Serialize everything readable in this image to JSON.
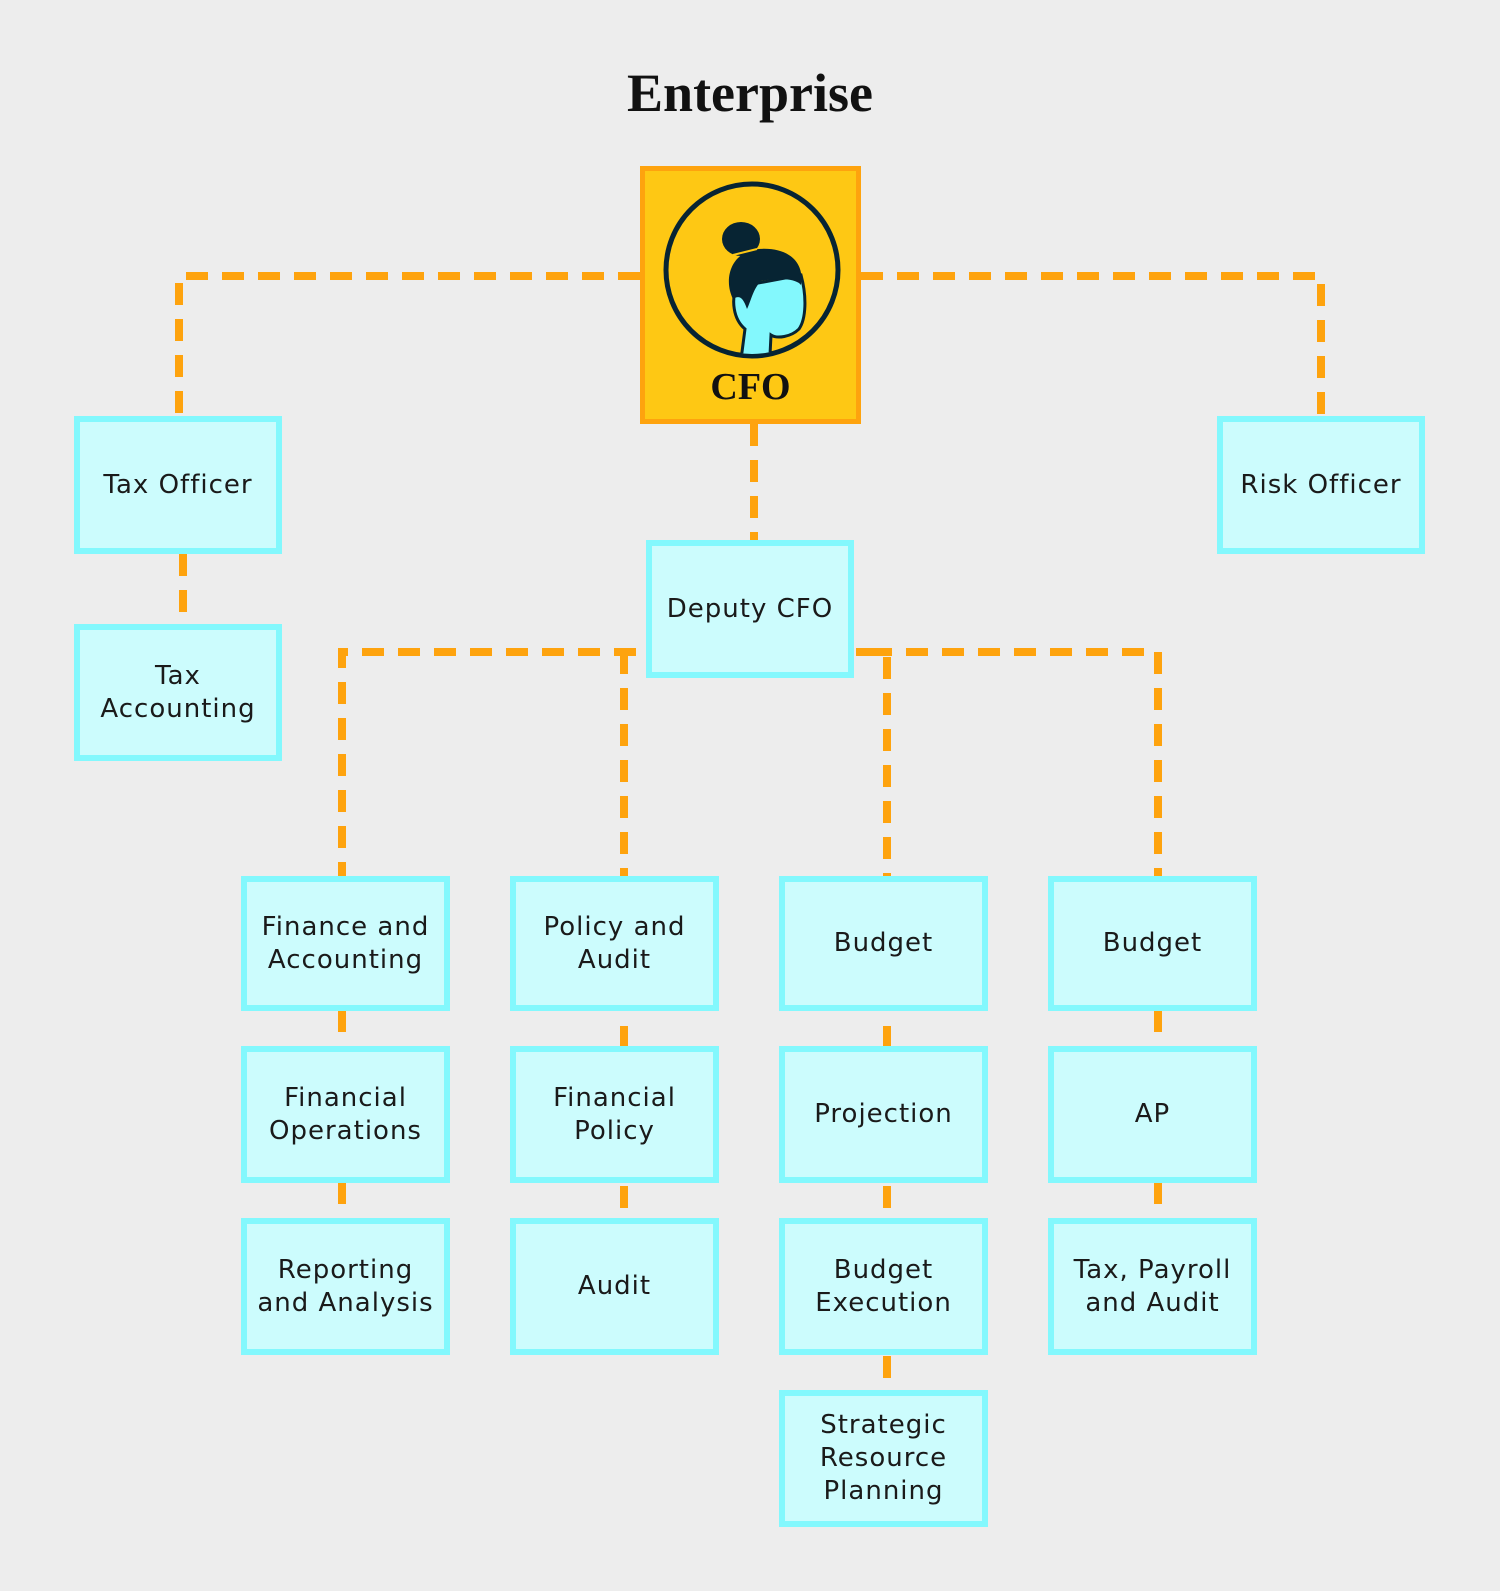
{
  "title": "Enterprise",
  "colors": {
    "background": "#ededed",
    "connector": "#fea30e",
    "node_fill": "#ccfcfd",
    "node_border": "#83f8fd",
    "root_fill": "#fec814",
    "root_border": "#fea30e"
  },
  "root": {
    "label": "CFO",
    "icon": "woman-avatar-icon"
  },
  "nodes": {
    "tax_officer": "Tax Officer",
    "tax_accounting": "Tax Accounting",
    "risk_officer": "Risk Officer",
    "deputy_cfo": "Deputy CFO",
    "finance_accounting": "Finance and Accounting",
    "financial_operations": "Financial Operations",
    "reporting_analysis": "Reporting and Analysis",
    "policy_audit": "Policy and Audit",
    "financial_policy": "Financial Policy",
    "audit": "Audit",
    "budget_1": "Budget",
    "projection": "Projection",
    "budget_execution": "Budget Execution",
    "strategic_resource_planning": "Strategic Resource Planning",
    "budget_2": "Budget",
    "ap": "AP",
    "tax_payroll_audit": "Tax, Payroll and Audit"
  },
  "edges": [
    [
      "cfo",
      "tax_officer"
    ],
    [
      "cfo",
      "risk_officer"
    ],
    [
      "cfo",
      "deputy_cfo"
    ],
    [
      "tax_officer",
      "tax_accounting"
    ],
    [
      "deputy_cfo",
      "finance_accounting"
    ],
    [
      "deputy_cfo",
      "policy_audit"
    ],
    [
      "deputy_cfo",
      "budget_1"
    ],
    [
      "deputy_cfo",
      "budget_2"
    ],
    [
      "finance_accounting",
      "financial_operations"
    ],
    [
      "financial_operations",
      "reporting_analysis"
    ],
    [
      "policy_audit",
      "financial_policy"
    ],
    [
      "financial_policy",
      "audit"
    ],
    [
      "budget_1",
      "projection"
    ],
    [
      "projection",
      "budget_execution"
    ],
    [
      "budget_execution",
      "strategic_resource_planning"
    ],
    [
      "budget_2",
      "ap"
    ],
    [
      "ap",
      "tax_payroll_audit"
    ]
  ]
}
